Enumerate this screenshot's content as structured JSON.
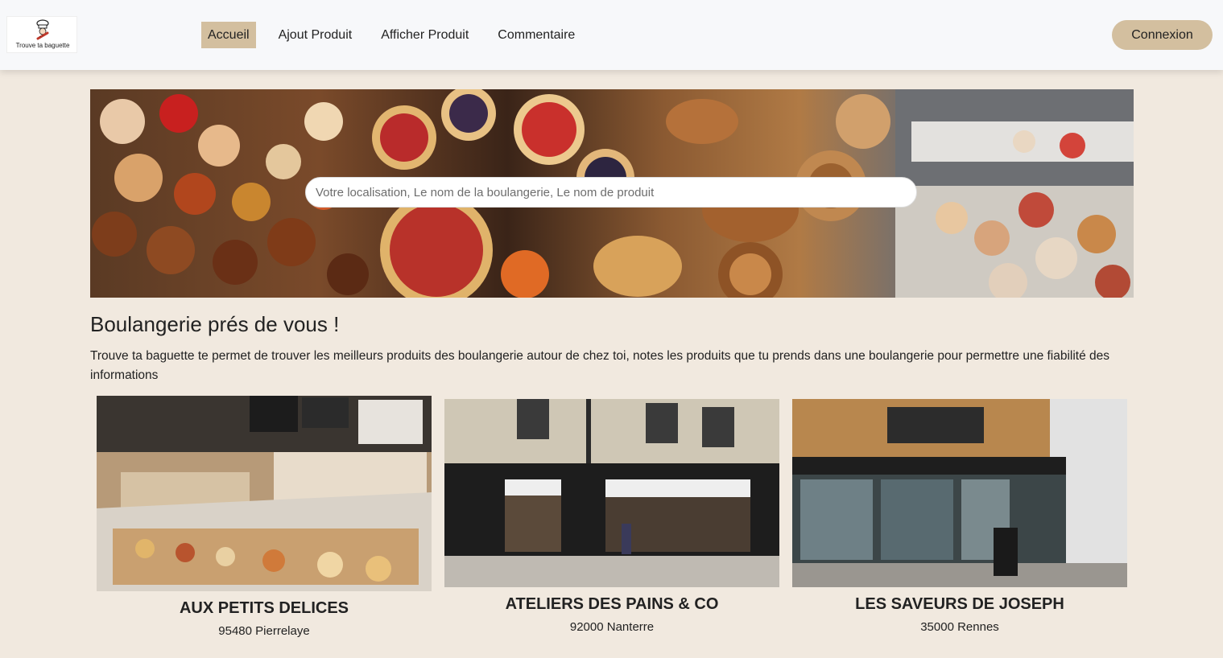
{
  "brand": {
    "logo_text": "Trouve ta baguette"
  },
  "nav": {
    "links": [
      "Accueil",
      "Ajout Produit",
      "Afficher Produit",
      "Commentaire"
    ],
    "active_index": 0,
    "login_label": "Connexion"
  },
  "hero": {
    "search_placeholder": "Votre localisation, Le nom de la boulangerie, Le nom de produit"
  },
  "main": {
    "title": "Boulangerie prés de vous !",
    "intro": "Trouve ta baguette te permet de trouver les meilleurs produits des boulangerie autour de chez toi, notes les produits que tu prends dans une boulangerie pour permettre une fiabilité des informations"
  },
  "bakeries": [
    {
      "name": "AUX PETITS DELICES",
      "city": "95480 Pierrelaye"
    },
    {
      "name": "ATELIERS DES PAINS & CO",
      "city": "92000 Nanterre"
    },
    {
      "name": "LES SAVEURS DE JOSEPH",
      "city": "35000 Rennes"
    }
  ],
  "colors": {
    "page_bg": "#f1e9df",
    "navbar_bg": "#f7f8fa",
    "accent": "#d3bf9f",
    "text": "#222222"
  }
}
